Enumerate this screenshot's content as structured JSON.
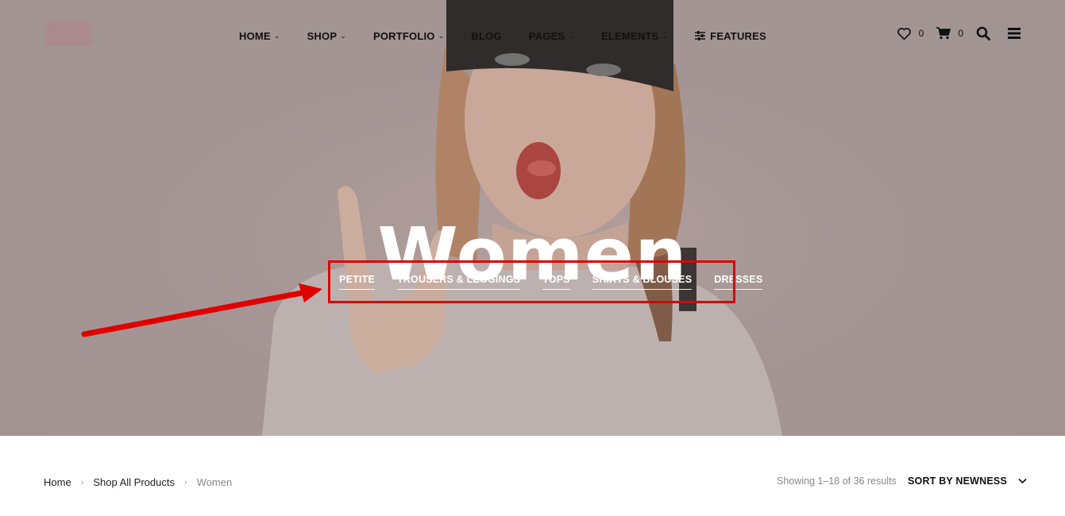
{
  "nav": {
    "items": [
      {
        "label": "HOME",
        "has_dropdown": true
      },
      {
        "label": "SHOP",
        "has_dropdown": true
      },
      {
        "label": "PORTFOLIO",
        "has_dropdown": true
      },
      {
        "label": "BLOG",
        "has_dropdown": false
      },
      {
        "label": "PAGES",
        "has_dropdown": true
      },
      {
        "label": "ELEMENTS",
        "has_dropdown": true
      },
      {
        "label": "FEATURES",
        "icon": "sliders-icon"
      }
    ],
    "chevron": "⌄"
  },
  "header": {
    "wishlist_count": "0",
    "cart_count": "0"
  },
  "hero": {
    "title": "Women",
    "categories": [
      "PETITE",
      "TROUSERS & LEGGINGS",
      "TOPS",
      "SHIRTS & BLOUSES",
      "DRESSES"
    ],
    "annotation_color": "#e00000"
  },
  "breadcrumb": {
    "items": [
      "Home",
      "Shop All Products"
    ],
    "current": "Women",
    "separator": "›"
  },
  "results": {
    "text": "Showing 1–18 of 36 results"
  },
  "sort": {
    "label": "SORT BY NEWNESS"
  }
}
